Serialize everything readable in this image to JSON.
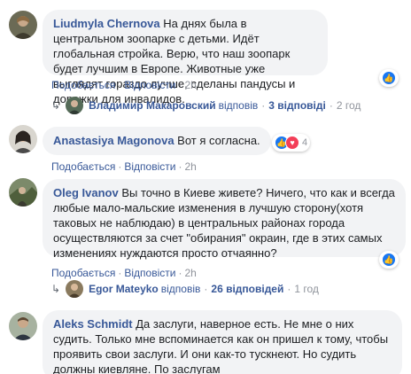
{
  "comments": [
    {
      "author": "Liudmyla Chernova",
      "text": "На днях была в центральном зоопарке с детьми. Идёт глобальная стройка. Верю, что наш зоопарк будет лучшим в Европе. Животные уже выглядят гораздо лучше, сделаны пандусы и дорожки для инвалидов.",
      "like_label": "Подобається",
      "reply_label": "Відповісти",
      "time": "2h",
      "reactions": {
        "icons": [
          "like-icon"
        ],
        "count": ""
      },
      "replies": {
        "name": "Владимир Макаровский",
        "verb": "відповів",
        "count": "3 відповіді",
        "time": "2 год"
      }
    },
    {
      "author": "Anastasiya Magonova",
      "text": "Вот я согласна.",
      "like_label": "Подобається",
      "reply_label": "Відповісти",
      "time": "2h",
      "reactions": {
        "icons": [
          "like-icon",
          "love-icon"
        ],
        "count": "4"
      }
    },
    {
      "author": "Oleg Ivanov",
      "text": "Вы точно в Киеве живете? Ничего, что как и всегда любые мало-мальские изменения в лучшую сторону(хотя таковых не наблюдаю) в центральных районах города осуществляются за счет \"обирания\" окраин, где в этих самых изменениях нуждаются просто отчаянно?",
      "like_label": "Подобається",
      "reply_label": "Відповісти",
      "time": "2h",
      "reactions": {
        "icons": [
          "like-icon"
        ],
        "count": ""
      },
      "replies": {
        "name": "Egor Mateyko",
        "verb": "відповів",
        "count": "26 відповідей",
        "time": "1 год"
      }
    },
    {
      "author": "Aleks Schmidt",
      "text": "Да заслуги, наверное есть. Не мне о них судить. Только мне вспоминается как он пришел к тому, чтобы проявить свои заслуги. И они как-то тускнеют. Но судить должны киевляне. По заслугам",
      "like_label": "",
      "reply_label": "",
      "time": ""
    }
  ],
  "colors": {
    "link": "#385898",
    "bubble": "#f2f3f5",
    "meta": "#90949c",
    "like": "#1877f2",
    "love": "#f33e58"
  }
}
